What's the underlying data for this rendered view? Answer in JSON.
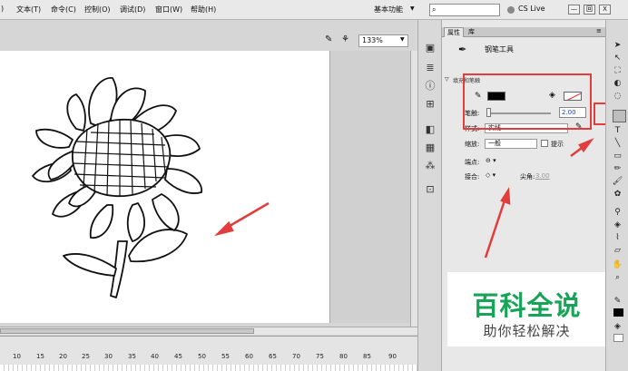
{
  "menu": {
    "items": [
      "文本(T)",
      "命令(C)",
      "控制(O)",
      "调试(D)",
      "窗口(W)",
      "帮助(H)"
    ],
    "partial_first": ")",
    "workspace": "基本功能",
    "cslive": "CS Live",
    "win_min": "—",
    "win_restore": "回",
    "win_close": "X"
  },
  "stage": {
    "zoom": "133%"
  },
  "timeline": {
    "ticks": [
      "10",
      "15",
      "20",
      "25",
      "30",
      "35",
      "40",
      "45",
      "50",
      "55",
      "60",
      "65",
      "70",
      "75",
      "80",
      "85",
      "90"
    ]
  },
  "panel": {
    "tab_properties": "属性",
    "tab_library": "库",
    "tool_name": "钢笔工具",
    "section_title": "填充和笔触",
    "stroke_label": "笔触:",
    "stroke_value": "2.00",
    "style_label": "样式:",
    "style_value": "实线",
    "scale_label": "缩放:",
    "scale_value": "一般",
    "hint_label": "提示",
    "cap_label": "端点:",
    "join_label": "接合:",
    "miter_label": "尖角:",
    "miter_value": "3.00"
  },
  "watermark": {
    "title": "百科全说",
    "subtitle": "助你轻松解决"
  },
  "colors": {
    "stroke_color": "#000000",
    "highlight_red": "#e23c3c",
    "watermark_green": "#17a457"
  },
  "icons": {
    "toolstrip": [
      "panel-icon",
      "align-icon",
      "info-icon",
      "transform-icon",
      "color-icon",
      "swatches-icon",
      "components-icon",
      "motion-icon"
    ],
    "tools": [
      "selection-icon",
      "subselection-icon",
      "free-transform-icon",
      "3d-rotation-icon",
      "lasso-icon",
      "pen-icon",
      "text-icon",
      "line-icon",
      "rectangle-icon",
      "pencil-icon",
      "brush-icon",
      "deco-icon",
      "bone-icon",
      "paint-bucket-icon",
      "eyedropper-icon",
      "eraser-icon",
      "hand-icon",
      "zoom-icon"
    ]
  }
}
